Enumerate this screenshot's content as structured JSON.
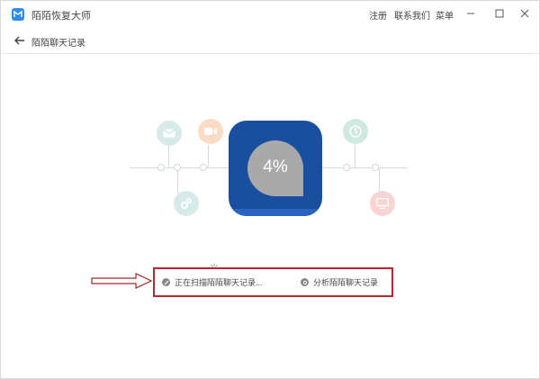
{
  "app": {
    "title": "陌陌恢复大师"
  },
  "menu": [
    "注册",
    "联系我们",
    "菜单"
  ],
  "nav": {
    "back_label": "陌陌聊天记录"
  },
  "progress": {
    "text": "4%",
    "value": 4
  },
  "steps": [
    {
      "label": "正在扫描陌陌聊天记录...",
      "icon": "pencil-icon"
    },
    {
      "label": "分析陌陌聊天记录",
      "icon": "gear-icon"
    }
  ],
  "colors": {
    "accent": "#2f8fe8",
    "progress_bg": "#1a4fa0",
    "highlight_border": "#b3272d"
  }
}
